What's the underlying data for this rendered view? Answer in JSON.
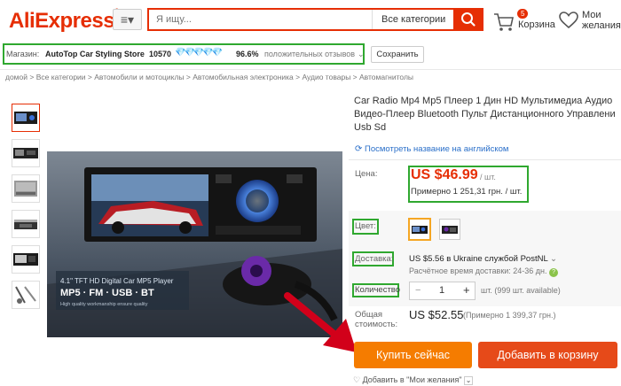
{
  "header": {
    "logo": "AliExpress",
    "logo_mark": "®",
    "menu_icon": "≡▾",
    "search_placeholder": "Я ищу...",
    "search_category": "Все категории",
    "cart_count": "5",
    "cart_label": "Корзина",
    "wish_label_1": "Мои",
    "wish_label_2": "желания"
  },
  "store": {
    "label": "Магазин:",
    "name": "AutoTop Car Styling Store",
    "score": "10570",
    "diamonds": "💎💎💎💎💎",
    "percent": "96.6%",
    "feedback": "положительных отзывов",
    "save_label": "Сохранить"
  },
  "breadcrumb": "домой > Все категории > Автомобили и мотоциклы > Автомобильная электроника > Аудио товары > Автомагнитолы",
  "product": {
    "title": "Car Radio Mp4 Mp5 Плеер 1 Дин HD Мультимедиа Аудио Видео-Плеер Bluetooth Пульт Дистанционного Управлени Usb Sd",
    "translate": "Посмотреть название на английском",
    "price_label": "Цена:",
    "price": "US $46.99",
    "price_unit": "/ шт.",
    "price_local": "Примерно 1 251,31 грн. / шт.",
    "color_label": "Цвет:",
    "delivery_label": "Доставка:",
    "delivery_value": "US $5.56 в Ukraine службой PostNL",
    "delivery_time": "Расчётное время доставки: 24-36 дн.",
    "qty_label": "Количество",
    "qty_value": "1",
    "qty_minus": "−",
    "qty_plus": "+",
    "qty_avail": "шт. (999 шт. available)",
    "total_label_1": "Общая",
    "total_label_2": "стоимость:",
    "total_value": "US $52.55",
    "total_local": "(Примерно 1 399,37 грн.)",
    "buy_now": "Купить сейчас",
    "add_to_cart": "Добавить в корзину",
    "add_wish": "Добавить в \"Мои желания\""
  },
  "image_text": {
    "line1": "4.1\" TFT HD Digital Car MP5 Player",
    "line2": "MP5 · FM · USB · BT",
    "line3": "High quality workmanship ensure quality"
  },
  "colors": {
    "brand": "#e62e04",
    "highlight": "#2fa82f",
    "buy": "#f57c00",
    "cart": "#e64a19",
    "link": "#2a6fc9"
  }
}
